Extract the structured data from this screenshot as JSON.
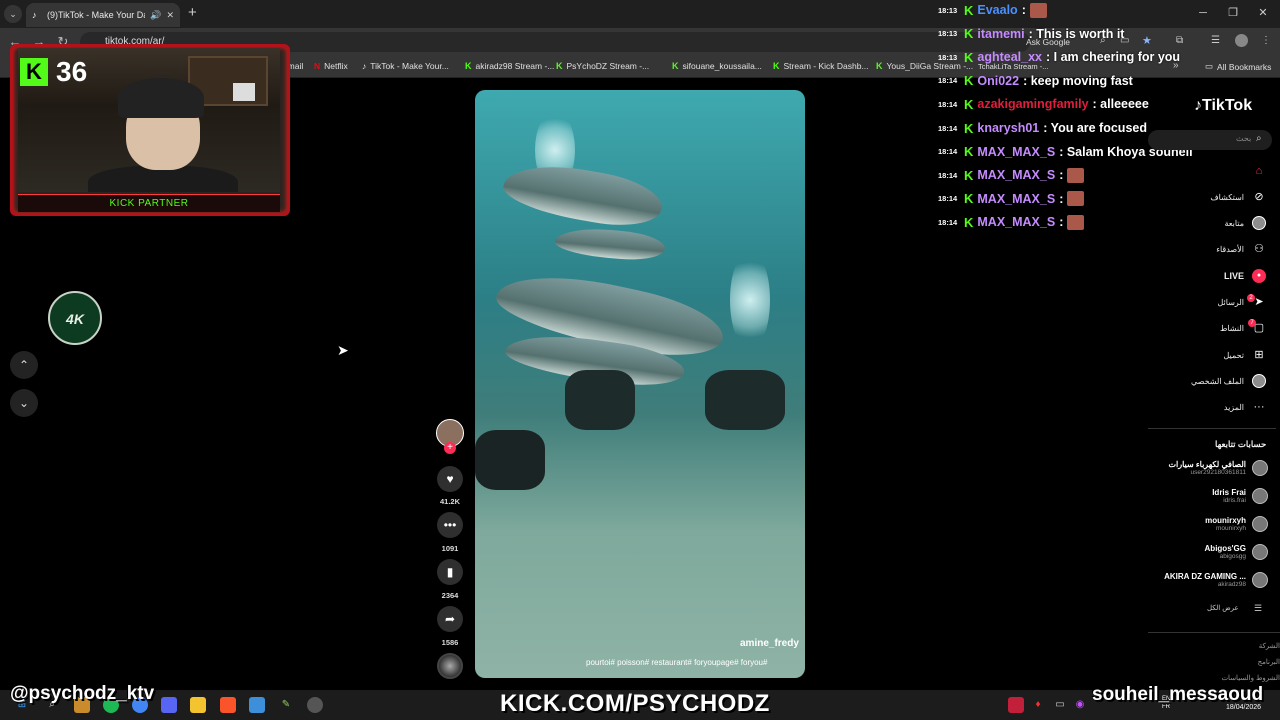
{
  "browser": {
    "tab_title": "(9)TikTok - Make Your Day",
    "url": "tiktok.com/ar/",
    "ask_google": "Ask Google",
    "bookmarks": [
      {
        "label": "Email"
      },
      {
        "label": "Netflix"
      },
      {
        "label": "TikTok - Make Your..."
      },
      {
        "label": "akiradz98 Stream -..."
      },
      {
        "label": "PsYchoDZ Stream -..."
      },
      {
        "label": "sifouane_koussaila..."
      },
      {
        "label": "Stream - Kick Dashb..."
      },
      {
        "label": "Yous_DiiGa Stream -..."
      },
      {
        "label": "TchakLiTa Stream -..."
      }
    ],
    "all_bookmarks": "All Bookmarks"
  },
  "stream_overlay": {
    "follower_count": "36",
    "kick_partner": "KICK PARTNER",
    "logo_text": "4K",
    "handle_left": "@psychodz_ktv",
    "kick_url": "KICK.COM/PSYCHODZ",
    "handle_right": "souheil_messaoud"
  },
  "chat": [
    {
      "time": "18:13",
      "user": "Evaalo",
      "user_color": "#4a90ff",
      "msg": ":",
      "emote": true
    },
    {
      "time": "18:13",
      "user": "itamemi",
      "user_color": "#c58bff",
      "msg": ": This is worth it",
      "emote": false
    },
    {
      "time": "18:13",
      "user": "aghteal_xx",
      "user_color": "#c58bff",
      "msg": ": I am cheering for you",
      "emote": false
    },
    {
      "time": "18:14",
      "user": "Oni022",
      "user_color": "#c58bff",
      "msg": ": keep moving fast",
      "emote": false
    },
    {
      "time": "18:14",
      "user": "azakigamingfamily",
      "user_color": "#e01e3c",
      "msg": ": alleeeee",
      "emote": false
    },
    {
      "time": "18:14",
      "user": "knarysh01",
      "user_color": "#c58bff",
      "msg": ": You are focused",
      "emote": false
    },
    {
      "time": "18:14",
      "user": "MAX_MAX_S",
      "user_color": "#c58bff",
      "msg": ": Salam Khoya souheil",
      "emote": false
    },
    {
      "time": "18:14",
      "user": "MAX_MAX_S",
      "user_color": "#c58bff",
      "msg": ":",
      "emote": true
    },
    {
      "time": "18:14",
      "user": "MAX_MAX_S",
      "user_color": "#c58bff",
      "msg": ":",
      "emote": true
    },
    {
      "time": "18:14",
      "user": "MAX_MAX_S",
      "user_color": "#c58bff",
      "msg": ":",
      "emote": true
    }
  ],
  "video": {
    "author": "amine_fredy",
    "description": "pourtoi# poisson# restaurant# foryoupage# foryou#"
  },
  "actions": {
    "likes": "41.2K",
    "comments": "1091",
    "saves": "2364",
    "shares": "1586"
  },
  "tiktok": {
    "logo": "TikTok",
    "search_placeholder": "بحث",
    "nav": [
      {
        "label": "",
        "icon": "home-icon"
      },
      {
        "label": "استكشاف",
        "icon": "explore-icon"
      },
      {
        "label": "متابعة",
        "icon": "following-icon"
      },
      {
        "label": "الأصدقاء",
        "icon": "friends-icon"
      },
      {
        "label": "LIVE",
        "icon": "live-icon"
      },
      {
        "label": "الرسائل",
        "icon": "messages-icon",
        "badge": "2"
      },
      {
        "label": "النشاط",
        "icon": "activity-icon",
        "badge": "7"
      },
      {
        "label": "تحميل",
        "icon": "upload-icon"
      },
      {
        "label": "الملف الشخصي",
        "icon": "profile-icon"
      },
      {
        "label": "المزيد",
        "icon": "more-icon"
      }
    ],
    "following_title": "حسابات تتابعها",
    "following": [
      {
        "name": "الصافي لكهرباء سيارات",
        "handle": "user292180361811"
      },
      {
        "name": "Idris Frai",
        "handle": "idris.frai"
      },
      {
        "name": "mounirxyh",
        "handle": "mounirxyh"
      },
      {
        "name": "Abigos'GG",
        "handle": "abigosgg"
      },
      {
        "name": "AKIRA DZ GAMING ...",
        "handle": "akiradz98"
      }
    ],
    "see_all": "عرض الكل",
    "footer": [
      "الشركة",
      "البرنامج",
      "الشروط والسياسات"
    ]
  },
  "taskbar": {
    "lang_top": "ENG",
    "lang_bottom": "FR",
    "date": "18/04/2026"
  }
}
